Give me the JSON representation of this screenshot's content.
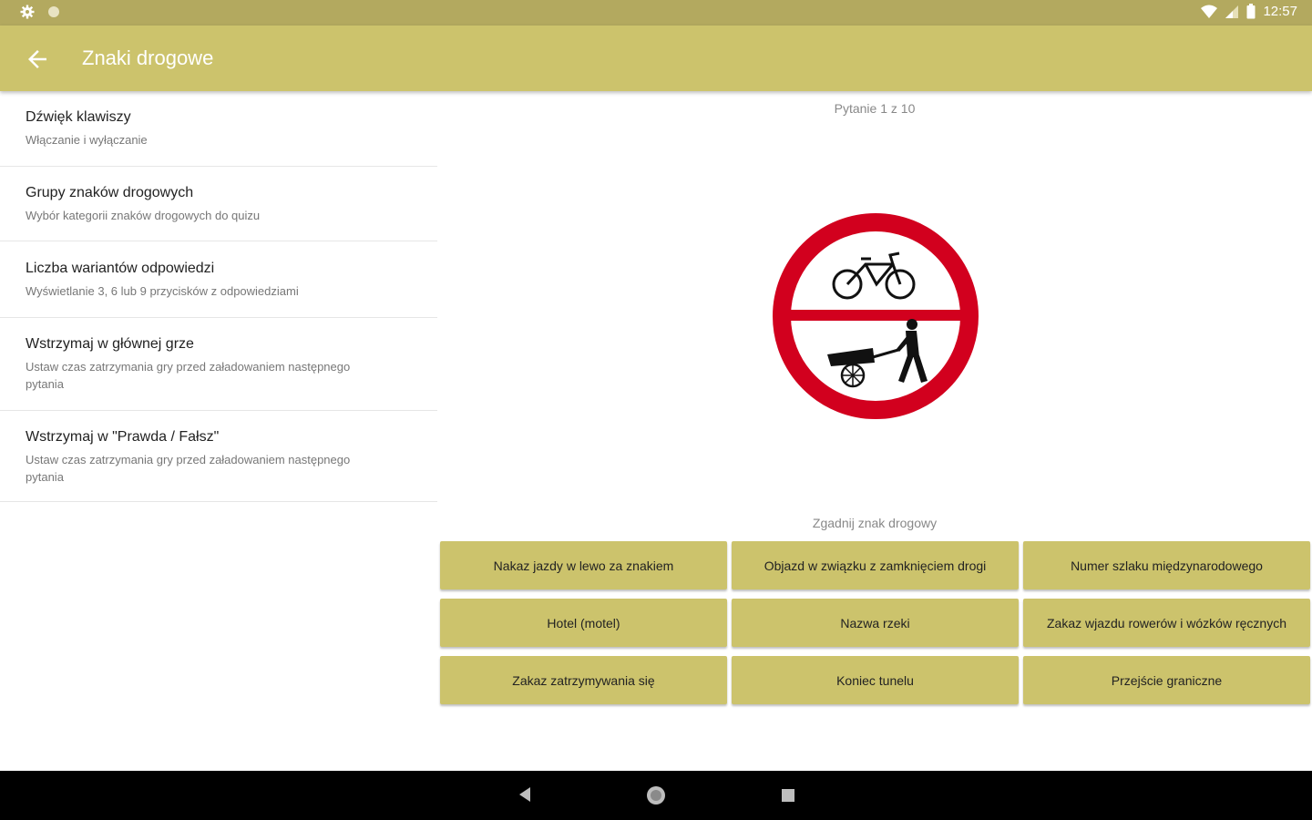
{
  "status_bar": {
    "time": "12:57",
    "left_icons": [
      "gear-icon",
      "circle-icon"
    ],
    "right_icons": [
      "wifi-icon",
      "signal-icon",
      "battery-icon"
    ]
  },
  "app_bar": {
    "title": "Znaki drogowe"
  },
  "settings": [
    {
      "title": "Dźwięk klawiszy",
      "subtitle": "Włączanie i wyłączanie"
    },
    {
      "title": "Grupy znaków drogowych",
      "subtitle": "Wybór kategorii znaków drogowych do quizu"
    },
    {
      "title": "Liczba wariantów odpowiedzi",
      "subtitle": "Wyświetlanie 3, 6 lub 9 przycisków z odpowiedziami"
    },
    {
      "title": "Wstrzymaj w głównej grze",
      "subtitle": "Ustaw czas zatrzymania gry przed załadowaniem następnego pytania"
    },
    {
      "title": "Wstrzymaj w \"Prawda / Fałsz\"",
      "subtitle": "Ustaw czas zatrzymania gry przed załadowaniem następnego pytania"
    }
  ],
  "quiz": {
    "question_counter": "Pytanie 1 z 10",
    "prompt": "Zgadnij znak drogowy",
    "answers": [
      "Nakaz jazdy w lewo za znakiem",
      "Objazd w związku z zamknięciem drogi",
      "Numer szlaku międzynarodowego",
      "Hotel (motel)",
      "Nazwa rzeki",
      "Zakaz wjazdu rowerów i wózków ręcznych",
      "Zakaz zatrzymywania się",
      "Koniec tunelu",
      "Przejście graniczne"
    ]
  },
  "colors": {
    "status_bar": "#b3a95f",
    "app_bar": "#ccc36c",
    "button": "#ccc36c",
    "sign_red": "#d2001e"
  },
  "nav_bar": {
    "icons": [
      "back-triangle-icon",
      "home-circle-icon",
      "recents-square-icon"
    ]
  }
}
